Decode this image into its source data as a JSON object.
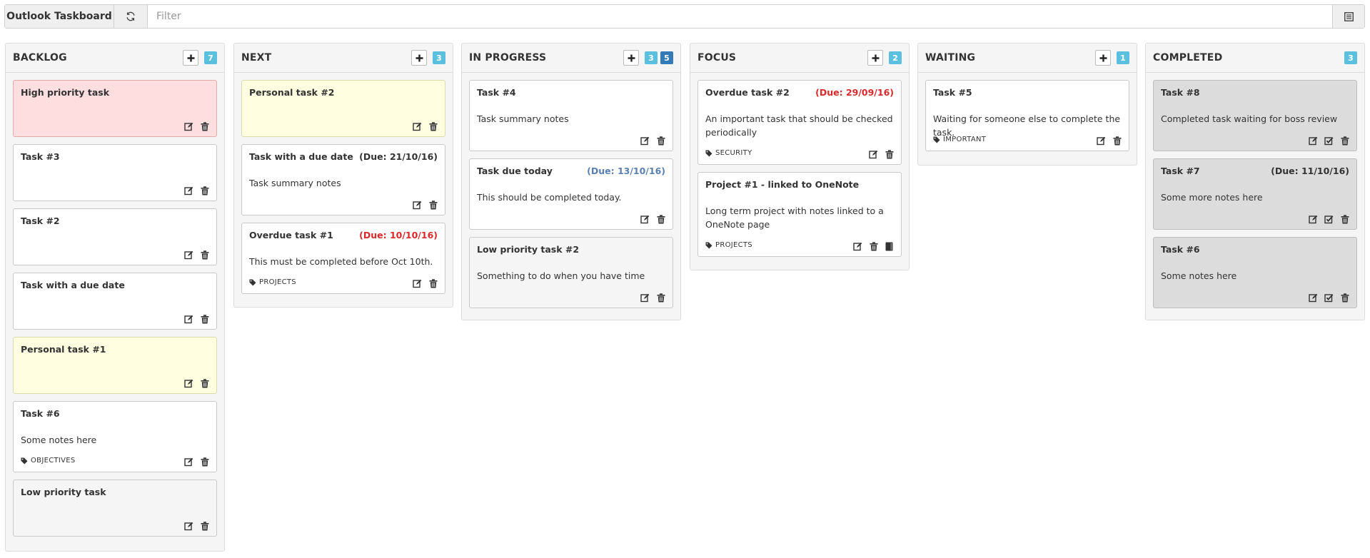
{
  "app": {
    "title": "Outlook Taskboard"
  },
  "filter": {
    "placeholder": "Filter",
    "value": ""
  },
  "columns": [
    {
      "title": "BACKLOG",
      "has_add": true,
      "badges": [
        "7"
      ],
      "cards": [
        {
          "title": "High priority task",
          "due": "",
          "notes": "",
          "tag": "",
          "style": "red"
        },
        {
          "title": "Task #3",
          "due": "",
          "notes": "",
          "tag": "",
          "style": ""
        },
        {
          "title": "Task #2",
          "due": "",
          "notes": "",
          "tag": "",
          "style": ""
        },
        {
          "title": "Task with a due date",
          "due": "",
          "notes": "",
          "tag": "",
          "style": ""
        },
        {
          "title": "Personal task #1",
          "due": "",
          "notes": "",
          "tag": "",
          "style": "yellow"
        },
        {
          "title": "Task #6",
          "due": "",
          "notes": "Some notes here",
          "tag": "OBJECTIVES",
          "style": ""
        },
        {
          "title": "Low priority task",
          "due": "",
          "notes": "",
          "tag": "",
          "style": "gray"
        }
      ]
    },
    {
      "title": "NEXT",
      "has_add": true,
      "badges": [
        "3"
      ],
      "cards": [
        {
          "title": "Personal task #2",
          "due": "",
          "notes": "",
          "tag": "",
          "style": "yellow"
        },
        {
          "title": "Task with a due date",
          "due": "(Due: 21/10/16)",
          "due_style": "",
          "notes": "Task summary notes",
          "tag": "",
          "style": ""
        },
        {
          "title": "Overdue task #1",
          "due": "(Due: 10/10/16)",
          "due_style": "overdue",
          "notes": "This must be completed before Oct 10th.",
          "tag": "PROJECTS",
          "style": ""
        }
      ]
    },
    {
      "title": "IN PROGRESS",
      "has_add": true,
      "badges": [
        "3",
        "5"
      ],
      "cards": [
        {
          "title": "Task #4",
          "due": "",
          "notes": "Task summary notes",
          "tag": "",
          "style": ""
        },
        {
          "title": "Task due today",
          "due": "(Due: 13/10/16)",
          "due_style": "today",
          "notes": "This should be completed today.",
          "tag": "",
          "style": ""
        },
        {
          "title": "Low priority task #2",
          "due": "",
          "notes": "Something to do when you have time",
          "tag": "",
          "style": "gray"
        }
      ]
    },
    {
      "title": "FOCUS",
      "has_add": true,
      "badges": [
        "2"
      ],
      "cards": [
        {
          "title": "Overdue task #2",
          "due": "(Due: 29/09/16)",
          "due_style": "overdue",
          "notes": "An important task that should be checked periodically",
          "tag": "SECURITY",
          "style": ""
        },
        {
          "title": "Project #1 - linked to OneNote",
          "due": "",
          "notes": "Long term project with notes linked to a OneNote page",
          "tag": "PROJECTS",
          "style": "",
          "onenote": true
        }
      ]
    },
    {
      "title": "WAITING",
      "has_add": true,
      "badges": [
        "1"
      ],
      "cards": [
        {
          "title": "Task #5",
          "due": "",
          "notes": "Waiting for someone else to complete the task.",
          "tag": "IMPORTANT",
          "style": ""
        }
      ]
    },
    {
      "title": "COMPLETED",
      "has_add": false,
      "badges": [
        "3"
      ],
      "cards": [
        {
          "title": "Task #8",
          "due": "",
          "notes": "Completed task waiting for boss review",
          "tag": "",
          "style": "done",
          "complete": true
        },
        {
          "title": "Task #7",
          "due": "(Due: 11/10/16)",
          "due_style": "",
          "notes": "Some more notes here",
          "tag": "",
          "style": "done",
          "complete": true
        },
        {
          "title": "Task #6",
          "due": "",
          "notes": "Some notes here",
          "tag": "",
          "style": "done",
          "complete": true
        }
      ]
    }
  ]
}
